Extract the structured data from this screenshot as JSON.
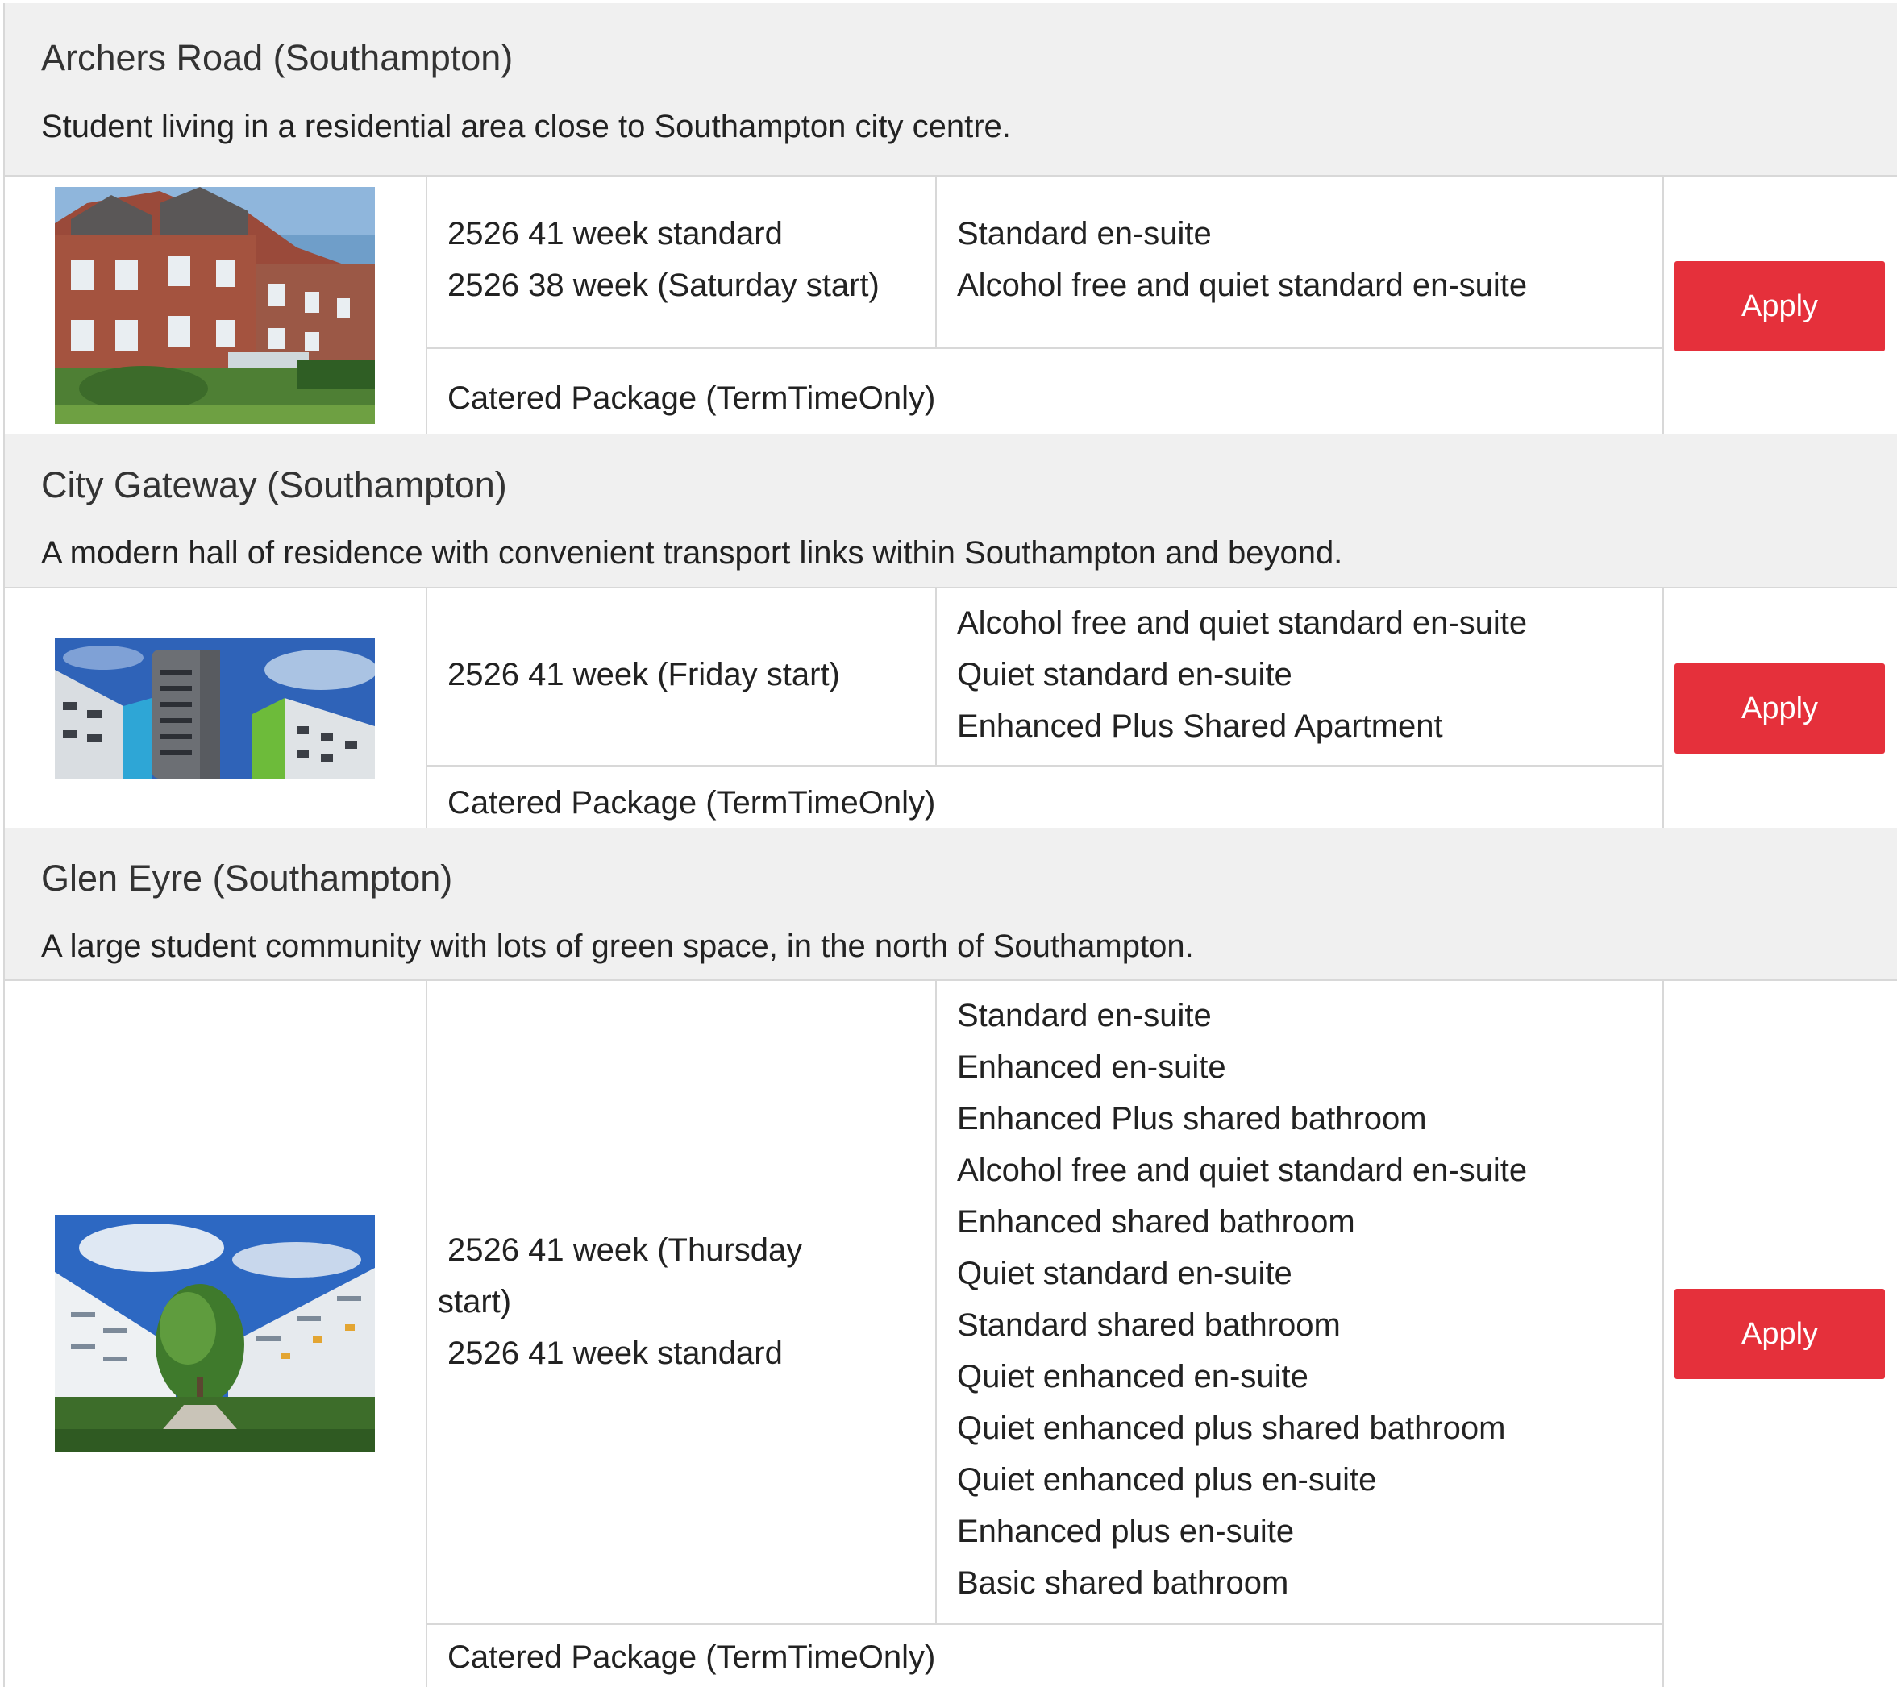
{
  "residences": [
    {
      "name": "Archers Road (Southampton)",
      "description": "Student living in a residential area close to Southampton city centre.",
      "contracts": [
        "2526 41 week standard",
        "2526 38 week (Saturday start)"
      ],
      "rooms": [
        "Standard en-suite",
        "Alcohol free and quiet standard en-suite"
      ],
      "package": "Catered Package (TermTimeOnly)",
      "apply_label": "Apply"
    },
    {
      "name": "City Gateway (Southampton)",
      "description": "A modern hall of residence with convenient transport links within Southampton and beyond.",
      "contracts": [
        "2526 41 week (Friday start)"
      ],
      "rooms": [
        "Alcohol free and quiet standard en-suite",
        "Quiet standard en-suite",
        "Enhanced Plus Shared Apartment"
      ],
      "package": "Catered Package (TermTimeOnly)",
      "apply_label": "Apply"
    },
    {
      "name": "Glen Eyre (Southampton)",
      "description": "A large student community with lots of green space, in the north of Southampton.",
      "contracts": [
        "2526 41 week (Thursday",
        "start)",
        "2526 41 week standard"
      ],
      "rooms": [
        "Standard en-suite",
        "Enhanced en-suite",
        "Enhanced Plus shared bathroom",
        "Alcohol free and quiet standard en-suite",
        "Enhanced shared bathroom",
        "Quiet standard en-suite",
        "Standard shared bathroom",
        "Quiet enhanced en-suite",
        "Quiet enhanced plus shared bathroom",
        "Quiet enhanced plus en-suite",
        "Enhanced plus en-suite",
        "Basic shared bathroom"
      ],
      "package": "Catered Package (TermTimeOnly)",
      "apply_label": "Apply"
    }
  ],
  "colors": {
    "apply_button": "#e5303b",
    "header_background": "#f0f0f0",
    "border": "#d8d8d8"
  }
}
